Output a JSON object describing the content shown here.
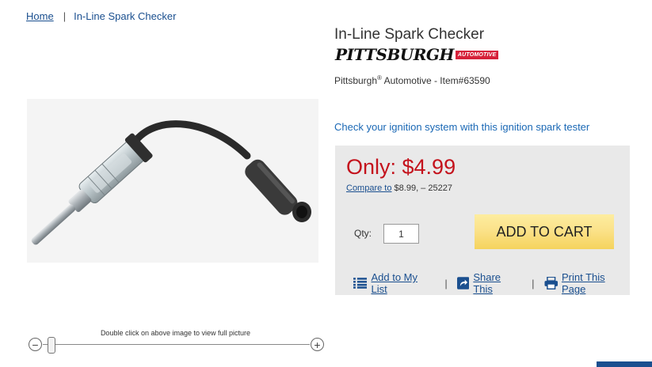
{
  "breadcrumb": {
    "home": "Home",
    "separator": "|",
    "current": "In-Line Spark Checker"
  },
  "image_viewer": {
    "caption": "Double click on above image to view full picture",
    "zoom_out": "−",
    "zoom_in": "+"
  },
  "product": {
    "title": "In-Line Spark Checker",
    "brand_logo_name": "PITTSBURGH",
    "brand_logo_badge": "AUTOMOTIVE",
    "brand": "Pittsburgh",
    "brand_mark": "®",
    "brand_suffix": " Automotive - Item#63590",
    "tagline": "Check your ignition system with this ignition spark tester"
  },
  "pricing": {
    "price": "Only: $4.99",
    "compare_link": "Compare to",
    "compare_value": " $8.99, – 25227",
    "qty_label": "Qty:",
    "qty_value": "1",
    "add_to_cart": "ADD TO CART"
  },
  "actions": {
    "add_to_list": "Add to My List",
    "share": "Share This",
    "print": "Print This Page",
    "separator": "|"
  },
  "colors": {
    "link": "#1a4f8f",
    "tagline": "#1a68b5",
    "price": "#c4121c",
    "cart_button": "#fbe28a",
    "badge": "#d6213a"
  }
}
